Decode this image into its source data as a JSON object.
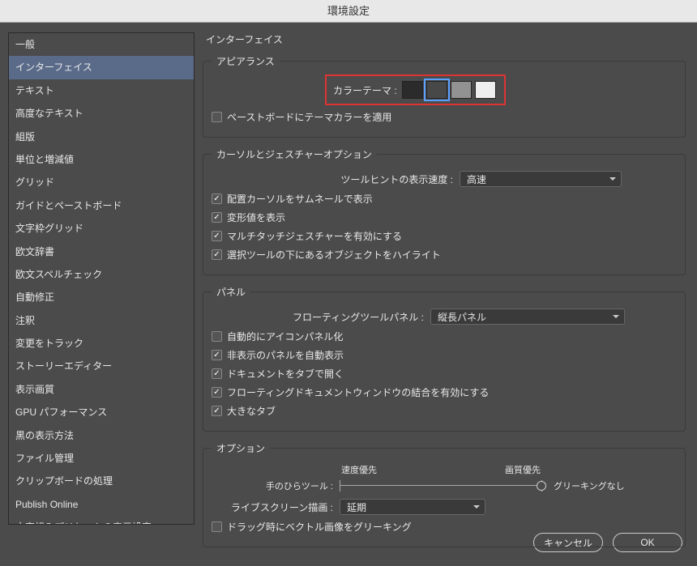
{
  "title": "環境設定",
  "sidebar": {
    "items": [
      "一般",
      "インターフェイス",
      "テキスト",
      "高度なテキスト",
      "組版",
      "単位と増減値",
      "グリッド",
      "ガイドとペーストボード",
      "文字枠グリッド",
      "欧文辞書",
      "欧文スペルチェック",
      "自動修正",
      "注釈",
      "変更をトラック",
      "ストーリーエディター",
      "表示画質",
      "GPU パフォーマンス",
      "黒の表示方法",
      "ファイル管理",
      "クリップボードの処理",
      "Publish Online",
      "文字組みプリセットの表示設定"
    ],
    "selectedIndex": 1
  },
  "content": {
    "heading": "インターフェイス",
    "appearance": {
      "legend": "アピアランス",
      "colorThemeLabel": "カラーテーマ :",
      "themes": [
        {
          "color": "#2b2b2b"
        },
        {
          "color": "#484848"
        },
        {
          "color": "#929292"
        },
        {
          "color": "#eeeeee"
        }
      ],
      "selectedTheme": 1,
      "pasteboardCheckbox": {
        "checked": false,
        "label": "ペーストボードにテーマカラーを適用"
      }
    },
    "cursor": {
      "legend": "カーソルとジェスチャーオプション",
      "toolHintLabel": "ツールヒントの表示速度 :",
      "toolHintValue": "高速",
      "checkboxes": [
        {
          "checked": true,
          "label": "配置カーソルをサムネールで表示"
        },
        {
          "checked": true,
          "label": "変形値を表示"
        },
        {
          "checked": true,
          "label": "マルチタッチジェスチャーを有効にする"
        },
        {
          "checked": true,
          "label": "選択ツールの下にあるオブジェクトをハイライト"
        }
      ]
    },
    "panel": {
      "legend": "パネル",
      "floatingLabel": "フローティングツールパネル :",
      "floatingValue": "縦長パネル",
      "checkboxes": [
        {
          "checked": false,
          "label": "自動的にアイコンパネル化"
        },
        {
          "checked": true,
          "label": "非表示のパネルを自動表示"
        },
        {
          "checked": true,
          "label": "ドキュメントをタブで開く"
        },
        {
          "checked": true,
          "label": "フローティングドキュメントウィンドウの結合を有効にする"
        },
        {
          "checked": true,
          "label": "大きなタブ"
        }
      ]
    },
    "options": {
      "legend": "オプション",
      "speedLabel": "速度優先",
      "qualityLabel": "画質優先",
      "handToolLabel": "手のひらツール :",
      "noGreekLabel": "グリーキングなし",
      "liveScreenLabel": "ライブスクリーン描画 :",
      "liveScreenValue": "延期",
      "dragCheckbox": {
        "checked": false,
        "label": "ドラッグ時にベクトル画像をグリーキング"
      }
    }
  },
  "footer": {
    "cancel": "キャンセル",
    "ok": "OK"
  }
}
